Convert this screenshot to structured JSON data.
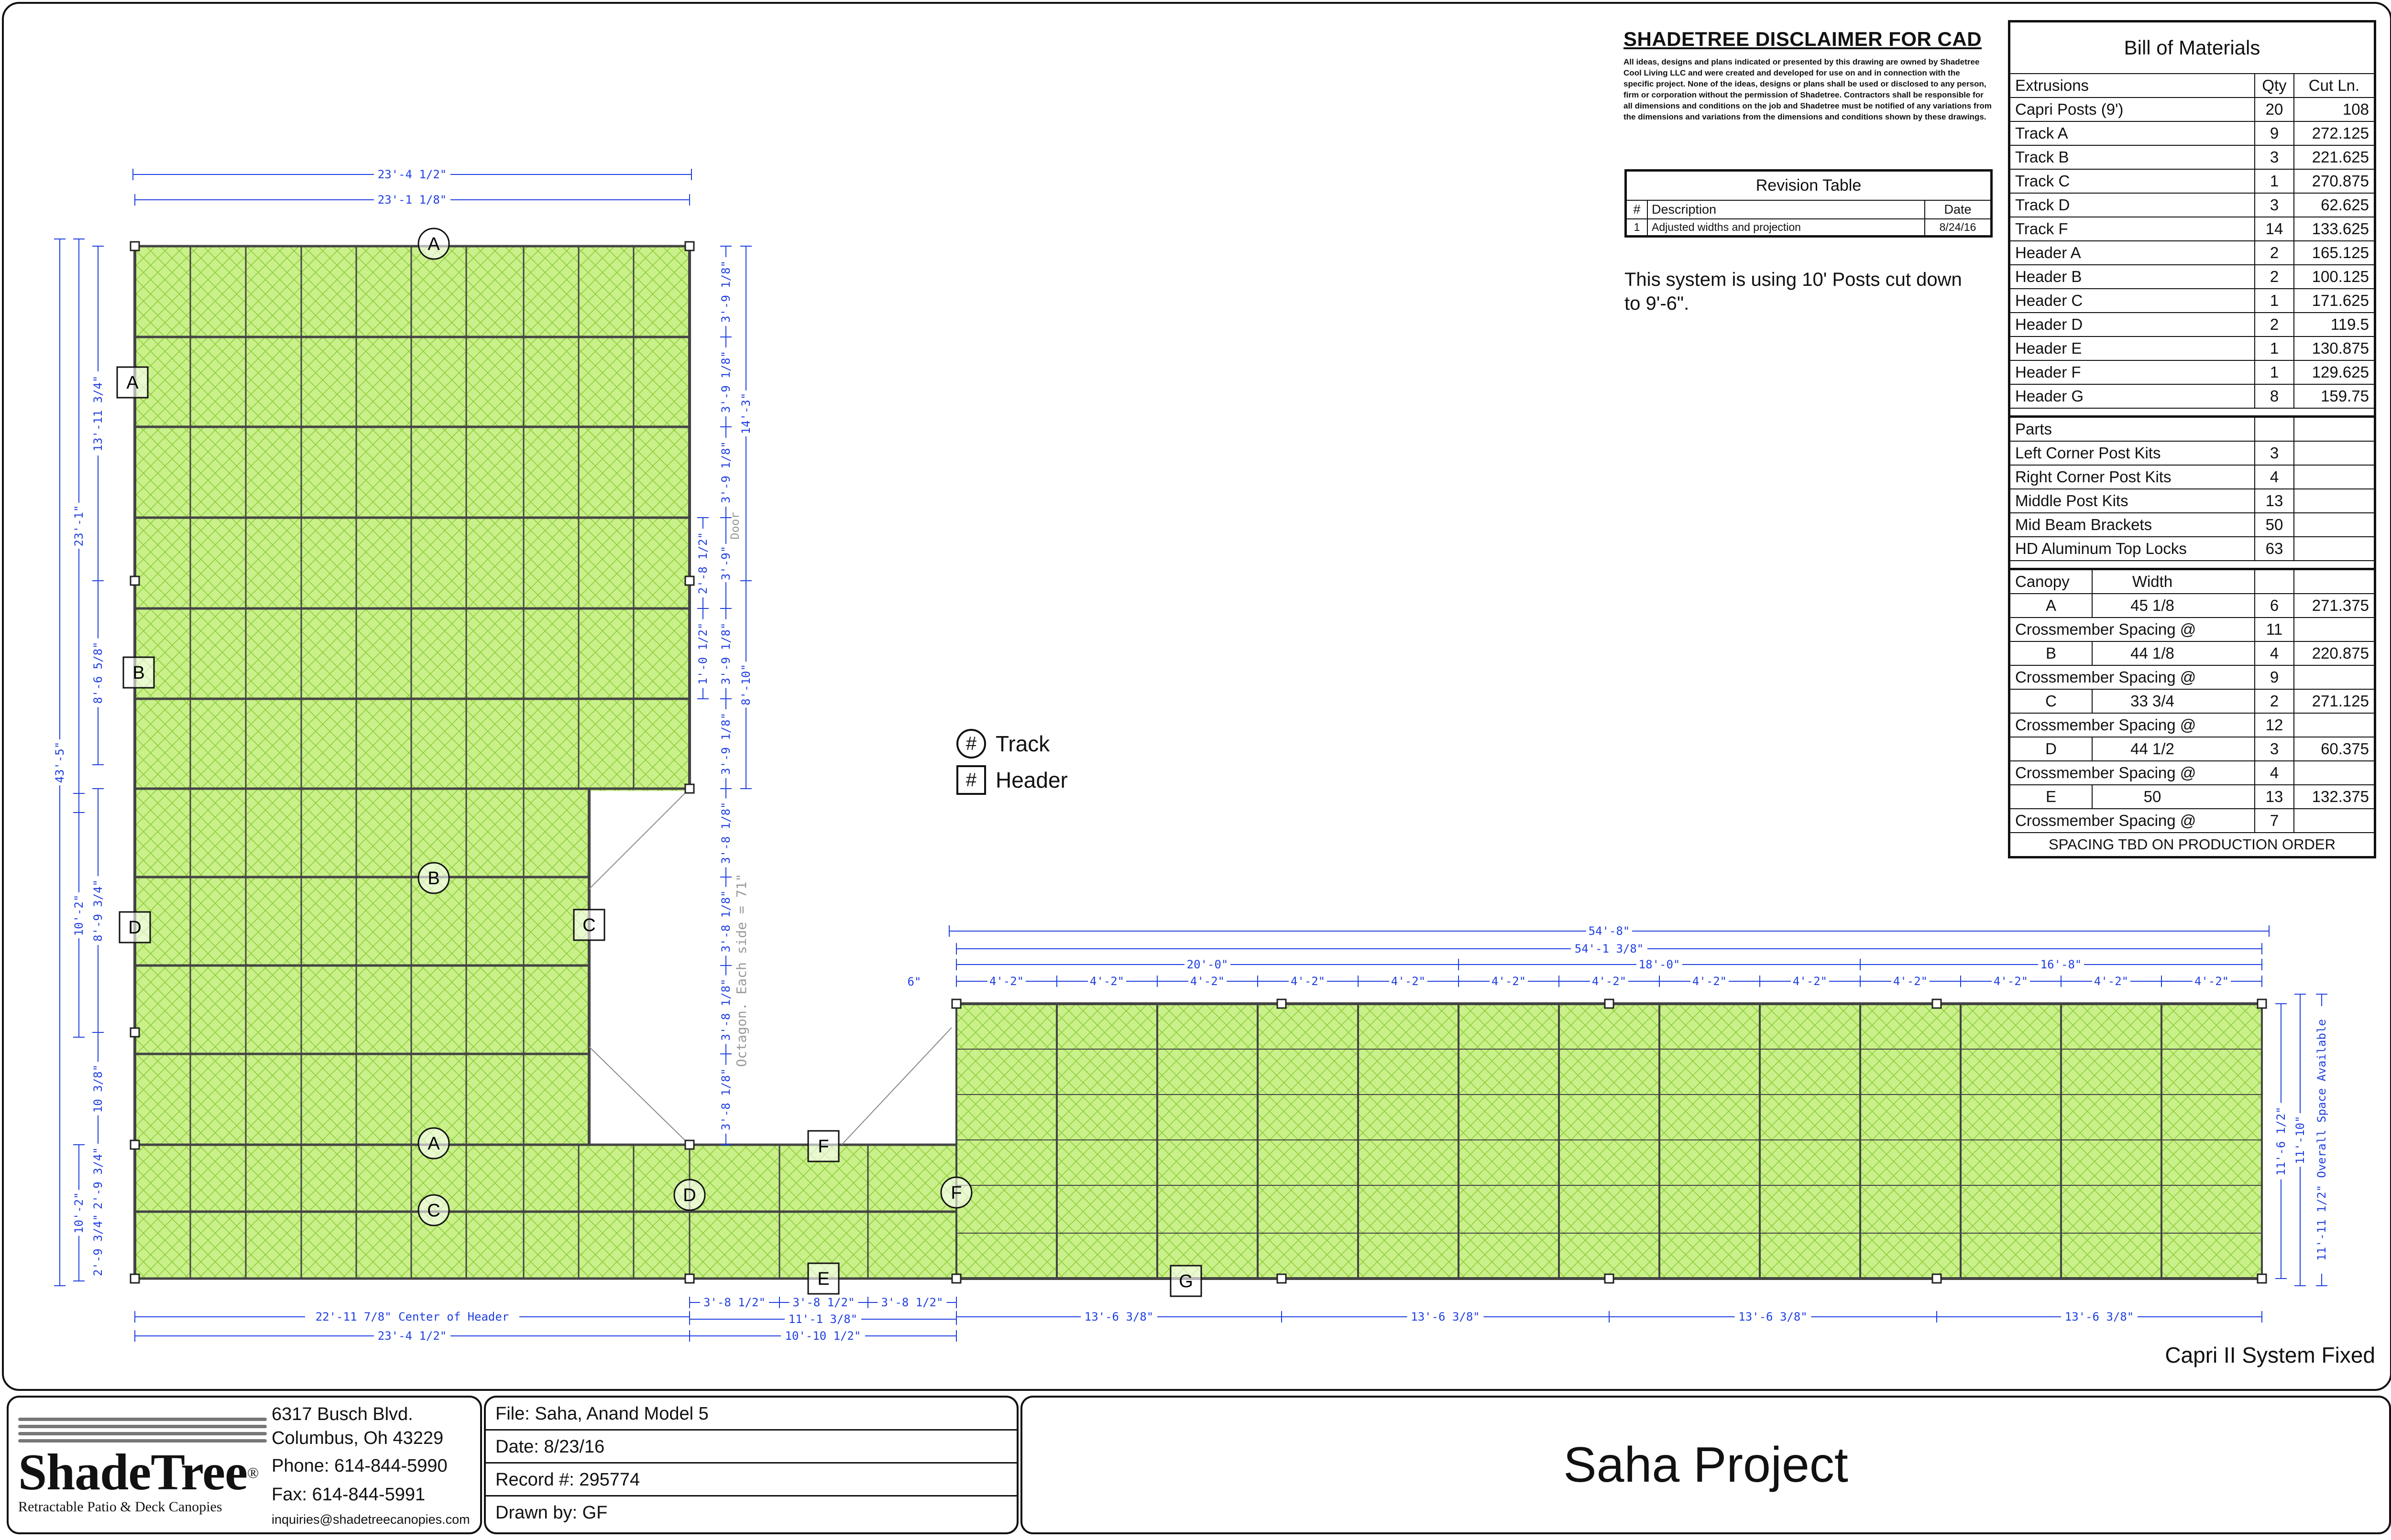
{
  "disclaimer": {
    "title": "SHADETREE DISCLAIMER FOR CAD",
    "body": "All ideas, designs and plans indicated or presented by this drawing are owned by Shadetree Cool Living LLC and were created and developed for use on and in connection with the specific project. None of the ideas, designs or plans shall be used or disclosed to any person, firm or corporation without the permission of Shadetree. Contractors shall be responsible for all dimensions and conditions on the job and Shadetree must be notified of any variations from the dimensions and variations from the dimensions and conditions shown by these drawings."
  },
  "revision_table": {
    "title": "Revision Table",
    "headers": [
      "#",
      "Description",
      "Date"
    ],
    "rows": [
      [
        "1",
        "Adjusted widths and projection",
        "8/24/16"
      ]
    ]
  },
  "posts_note": "This system is using 10' Posts cut down to 9'-6\".",
  "bom": {
    "title": "Bill of Materials",
    "ext_headers": [
      "Extrusions",
      "Qty",
      "Cut Ln."
    ],
    "extrusions": [
      [
        "Capri Posts (9')",
        "20",
        "108"
      ],
      [
        "Track A",
        "9",
        "272.125"
      ],
      [
        "Track B",
        "3",
        "221.625"
      ],
      [
        "Track C",
        "1",
        "270.875"
      ],
      [
        "Track D",
        "3",
        "62.625"
      ],
      [
        "Track F",
        "14",
        "133.625"
      ],
      [
        "Header A",
        "2",
        "165.125"
      ],
      [
        "Header B",
        "2",
        "100.125"
      ],
      [
        "Header C",
        "1",
        "171.625"
      ],
      [
        "Header D",
        "2",
        "119.5"
      ],
      [
        "Header E",
        "1",
        "130.875"
      ],
      [
        "Header F",
        "1",
        "129.625"
      ],
      [
        "Header G",
        "8",
        "159.75"
      ]
    ],
    "parts_header": "Parts",
    "parts": [
      [
        "Left Corner Post Kits",
        "3"
      ],
      [
        "Right Corner Post Kits",
        "4"
      ],
      [
        "Middle Post Kits",
        "13"
      ],
      [
        "Mid Beam Brackets",
        "50"
      ],
      [
        "HD Aluminum Top Locks",
        "63"
      ]
    ],
    "canopy_headers": [
      "Canopy",
      "Width"
    ],
    "spacing_label": "Crossmember Spacing @",
    "canopy": [
      {
        "name": "A",
        "width": "45 1/8",
        "qty": "6",
        "len": "271.375",
        "spacing": "11"
      },
      {
        "name": "B",
        "width": "44 1/8",
        "qty": "4",
        "len": "220.875",
        "spacing": "9"
      },
      {
        "name": "C",
        "width": "33 3/4",
        "qty": "2",
        "len": "271.125",
        "spacing": "12"
      },
      {
        "name": "D",
        "width": "44 1/2",
        "qty": "3",
        "len": "60.375",
        "spacing": "4"
      },
      {
        "name": "E",
        "width": "50",
        "qty": "13",
        "len": "132.375",
        "spacing": "7"
      }
    ],
    "footer": "SPACING TBD ON PRODUCTION ORDER"
  },
  "legend": {
    "symbol": "#",
    "track": "Track",
    "header": "Header"
  },
  "system_name": "Capri II System Fixed",
  "title_block": {
    "brand": "ShadeTree",
    "reg": "®",
    "tagline": "Retractable Patio & Deck Canopies",
    "address1": "6317 Busch Blvd.",
    "address2": "Columbus, Oh 43229",
    "phone": "Phone: 614-844-5990",
    "fax": "Fax: 614-844-5991",
    "email": "inquiries@shadetreecanopies.com",
    "file": "File:  Saha, Anand Model 5",
    "date": "Date:  8/23/16",
    "record": "Record #:  295774",
    "drawn": "Drawn by:  GF",
    "project": "Saha Project"
  },
  "drawing": {
    "colors": {
      "dim": "#1f3fe0",
      "canopy": "#c9f08a",
      "hatch": "#8fcc3a",
      "frame": "#444444",
      "note": "#9a9a9a"
    },
    "dims": {
      "left_top_outer": "23'-4 1/2\"",
      "left_top_inner": "23'-1 1/8\"",
      "left_v1": "13'-11 3/4\"",
      "left_v2": "23'-1\"",
      "left_v3": "43'-5\"",
      "left_v4": "8'-6 5/8\"",
      "left_v5": "10'-2\"",
      "left_v6": "8'-9 3/4\"",
      "left_v7": "10 3/8\"",
      "left_v8": "10'-2\"",
      "left_v9": "2'-9 3/4\"",
      "left_v10": "2'-9 3/4\"",
      "right_a": [
        "3'-9 1/8\"",
        "3'-9 1/8\"",
        "3'-9 1/8\"",
        "3'-9\"",
        "3'-9 1/8\"",
        "3'-9 1/8\""
      ],
      "right_b": [
        "3'-8 1/8\"",
        "3'-8 1/8\"",
        "3'-8 1/8\"",
        "3'-8 1/8\""
      ],
      "right_14": "14'-3\"",
      "right_8": "8'-10\"",
      "right_2_8": "2'-8 1/2\"",
      "right_1_0": "1'-0 1/2\"",
      "door": "Door",
      "octagon": "Octagon. Each side = 71\"",
      "bottom_left_a": "22'-11 7/8\" Center of Header",
      "bottom_left_b": "23'-4 1/2\"",
      "bottom_mid_small": [
        "3'-8 1/2\"",
        "3'-8 1/2\"",
        "3'-8 1/2\""
      ],
      "bottom_mid_a": "11'-1 3/8\"",
      "bottom_mid_b": "10'-10 1/2\"",
      "bottom_right": [
        "13'-6 3/8\"",
        "13'-6 3/8\"",
        "13'-6 3/8\"",
        "13'-6 3/8\""
      ],
      "top_right_total": "54'-8\"",
      "top_right_inner": "54'-1 3/8\"",
      "top_right_groups": [
        "20'-0\"",
        "18'-0\"",
        "16'-8\""
      ],
      "top_right_bays": [
        "4'-2\"",
        "4'-2\"",
        "4'-2\"",
        "4'-2\"",
        "4'-2\"",
        "4'-2\"",
        "4'-2\"",
        "4'-2\"",
        "4'-2\"",
        "4'-2\"",
        "4'-2\"",
        "4'-2\"",
        "4'-2\""
      ],
      "six": "6\"",
      "right_side": [
        "11'-6 1/2\"",
        "11'-10\"",
        "11'-11 1/2\" Overall Space Available"
      ]
    },
    "labels": {
      "A": "A",
      "B": "B",
      "C": "C",
      "D": "D",
      "E": "E",
      "F": "F",
      "G": "G"
    }
  }
}
